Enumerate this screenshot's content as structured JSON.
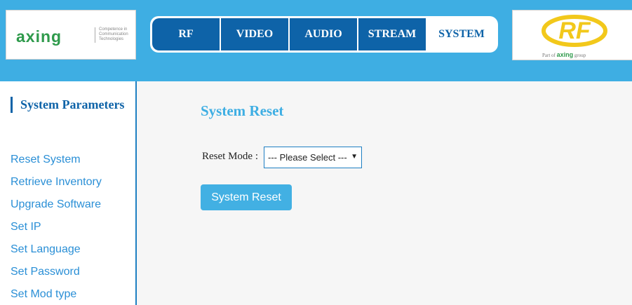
{
  "brand": {
    "logo_text": "axing",
    "tagline": [
      "Competence in",
      "Communication",
      "Technologies"
    ],
    "partner_prefix": "Part of",
    "partner_brand": "axing",
    "partner_suffix": "group",
    "partner_logo_text": "RF"
  },
  "nav": {
    "tabs": [
      {
        "label": "RF"
      },
      {
        "label": "VIDEO"
      },
      {
        "label": "AUDIO"
      },
      {
        "label": "STREAM"
      },
      {
        "label": "SYSTEM",
        "active": true
      }
    ]
  },
  "sidebar": {
    "title": "System Parameters",
    "items": [
      {
        "label": "Reset System"
      },
      {
        "label": "Retrieve Inventory"
      },
      {
        "label": "Upgrade Software"
      },
      {
        "label": "Set IP"
      },
      {
        "label": "Set Language"
      },
      {
        "label": "Set Password"
      },
      {
        "label": "Set Mod type"
      }
    ]
  },
  "main": {
    "title": "System Reset",
    "reset_mode_label": "Reset Mode :",
    "reset_mode_selected": "--- Please Select ---",
    "reset_button_label": "System Reset"
  },
  "colors": {
    "header_bg": "#3eaee3",
    "tab_bg": "#0e63a8",
    "accent": "#3eaee3",
    "link": "#2a8fd6",
    "logo_green": "#2e9a4b",
    "rf_yellow": "#f2c81b"
  }
}
